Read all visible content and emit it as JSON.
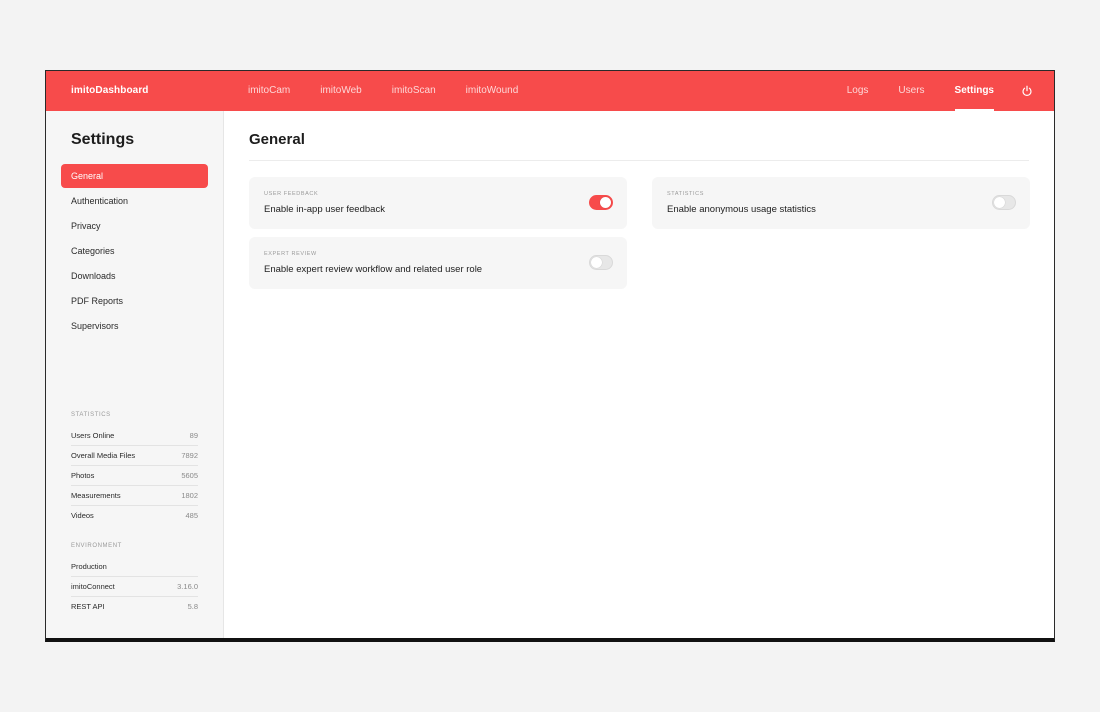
{
  "colors": {
    "accent": "#f74b4b",
    "background": "#f3f3f3",
    "panel": "#f6f6f6"
  },
  "header": {
    "brand": "imitoDashboard",
    "apps": [
      "imitoCam",
      "imitoWeb",
      "imitoScan",
      "imitoWound"
    ],
    "nav": [
      "Logs",
      "Users",
      "Settings"
    ],
    "active_nav": "Settings",
    "power_icon": "power-icon"
  },
  "sidebar": {
    "title": "Settings",
    "items": [
      "General",
      "Authentication",
      "Privacy",
      "Categories",
      "Downloads",
      "PDF Reports",
      "Supervisors"
    ],
    "active_item": "General",
    "statistics": {
      "label": "STATISTICS",
      "rows": [
        {
          "label": "Users Online",
          "value": "89"
        },
        {
          "label": "Overall Media Files",
          "value": "7892"
        },
        {
          "label": "Photos",
          "value": "5605"
        },
        {
          "label": "Measurements",
          "value": "1802"
        },
        {
          "label": "Videos",
          "value": "485"
        }
      ]
    },
    "environment": {
      "label": "ENVIRONMENT",
      "rows": [
        {
          "label": "Production",
          "value": ""
        },
        {
          "label": "imitoConnect",
          "value": "3.16.0"
        },
        {
          "label": "REST API",
          "value": "5.8"
        }
      ]
    }
  },
  "main": {
    "title": "General",
    "settings": [
      {
        "label": "USER FEEDBACK",
        "text": "Enable in-app user feedback",
        "enabled": true
      },
      {
        "label": "STATISTICS",
        "text": "Enable anonymous usage statistics",
        "enabled": false
      },
      {
        "label": "EXPERT REVIEW",
        "text": "Enable expert review workflow and related user role",
        "enabled": false
      }
    ]
  }
}
